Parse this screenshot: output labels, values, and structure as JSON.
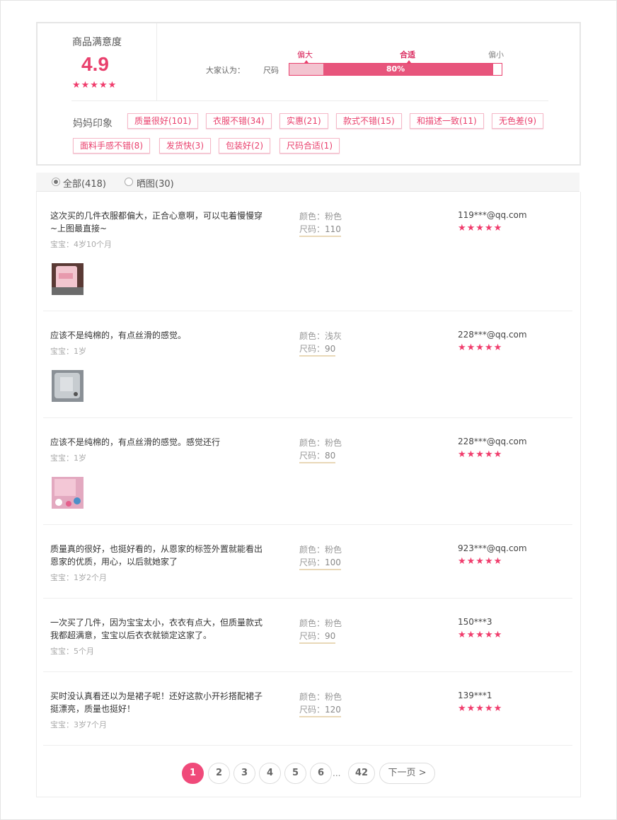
{
  "summary": {
    "title": "商品满意度",
    "score": "4.9",
    "stars": "★★★★★",
    "think_label": "大家认为：",
    "size_label": "尺码",
    "marks": {
      "big": "偏大",
      "fit": "合适",
      "small": "偏小"
    },
    "bar": {
      "big_share": 0.16,
      "fit_share": 0.8,
      "fit_text": "80%"
    },
    "accent_color": "#e9406d"
  },
  "impressions": {
    "label": "妈妈印象",
    "tags": [
      "质量很好(101)",
      "衣服不错(34)",
      "实惠(21)",
      "款式不错(15)",
      "和描述一致(11)",
      "无色差(9)",
      "面料手感不错(8)",
      "发货快(3)",
      "包装好(2)",
      "尺码合适(1)"
    ]
  },
  "filter": {
    "all_label": "全部(418)",
    "photo_label": "晒图(30)"
  },
  "reviews": [
    {
      "text": "这次买的几件衣服都偏大，正合心意啊，可以屯着慢慢穿~上图最直接~",
      "baby": "宝宝：4岁10个月",
      "color_label": "颜色：粉色",
      "size_key": "尺码：",
      "size_val": "110",
      "user": "119***@qq.com",
      "stars": "★★★★★",
      "photo": "pink-clothes-photo"
    },
    {
      "text": "应该不是纯棉的，有点丝滑的感觉。",
      "baby": "宝宝：1岁",
      "color_label": "颜色：浅灰",
      "size_key": "尺码：",
      "size_val": "90",
      "user": "228***@qq.com",
      "stars": "★★★★★",
      "photo": "gray-clothes-photo"
    },
    {
      "text": "应该不是纯棉的，有点丝滑的感觉。感觉还行",
      "baby": "宝宝：1岁",
      "color_label": "颜色：粉色",
      "size_key": "尺码：",
      "size_val": "80",
      "user": "228***@qq.com",
      "stars": "★★★★★",
      "photo": "pink-floral-photo"
    },
    {
      "text": "质量真的很好，也挺好看的，从恩家的标签外置就能看出恩家的优质，用心，以后就她家了",
      "baby": "宝宝：1岁2个月",
      "color_label": "颜色：粉色",
      "size_key": "尺码：",
      "size_val": "100",
      "user": "923***@qq.com",
      "stars": "★★★★★"
    },
    {
      "text": "一次买了几件，因为宝宝太小，衣衣有点大，但质量款式我都超满意，宝宝以后衣衣就锁定这家了。",
      "baby": "宝宝：5个月",
      "color_label": "颜色：粉色",
      "size_key": "尺码：",
      "size_val": "90",
      "user": "150***3",
      "stars": "★★★★★"
    },
    {
      "text": "买时没认真看还以为是裙子呢！还好这款小开衫搭配裙子挺漂亮，质量也挺好！",
      "baby": "宝宝：3岁7个月",
      "color_label": "颜色：粉色",
      "size_key": "尺码：",
      "size_val": "120",
      "user": "139***1",
      "stars": "★★★★★"
    }
  ],
  "pagination": {
    "pages": [
      "1",
      "2",
      "3",
      "4",
      "5",
      "6"
    ],
    "current": "1",
    "dots": "...",
    "last": "42",
    "next": "下一页 >"
  }
}
